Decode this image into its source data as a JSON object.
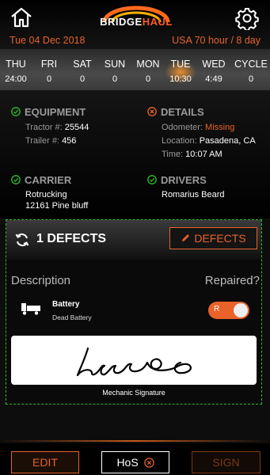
{
  "header": {
    "logo_text_1": "BRIDGE",
    "logo_text_2": "HAUL",
    "date": "Tue 04 Dec 2018",
    "hours_rule": "USA 70 hour / 8 day"
  },
  "days": [
    {
      "name": "THU",
      "value": "24:00"
    },
    {
      "name": "FRI",
      "value": "0"
    },
    {
      "name": "SAT",
      "value": "0"
    },
    {
      "name": "SUN",
      "value": "0"
    },
    {
      "name": "MON",
      "value": "0"
    },
    {
      "name": "TUE",
      "value": "10:30"
    },
    {
      "name": "WED",
      "value": "4:49"
    },
    {
      "name": "CYCLE",
      "value": "0"
    }
  ],
  "equipment": {
    "heading": "EQUIPMENT",
    "tractor_label": "Tractor #:",
    "tractor_value": "25544",
    "trailer_label": "Trailer #:",
    "trailer_value": "456"
  },
  "details": {
    "heading": "DETAILS",
    "odometer_label": "Odometer:",
    "odometer_value": "Missing",
    "location_label": "Location:",
    "location_value": "Pasadena, CA",
    "time_label": "Time:",
    "time_value": "10:07 AM"
  },
  "carrier": {
    "heading": "CARRIER",
    "name": "Rotrucking",
    "address": "12161 Pine bluff"
  },
  "drivers": {
    "heading": "DRIVERS",
    "name": "Romarius Beard"
  },
  "defects": {
    "title": "1 DEFECTS",
    "button_label": "DEFECTS",
    "description_label": "Description",
    "repaired_label": "Repaired?",
    "items": [
      {
        "name": "Battery",
        "description": "Dead Battery",
        "toggle_label": "R"
      }
    ],
    "signature_label": "Mechanic Signature"
  },
  "footer": {
    "edit_label": "EDIT",
    "hos_label": "HoS",
    "sign_label": "SIGN"
  },
  "colors": {
    "accent": "#e8622a",
    "check_green": "#2bbd2b",
    "dashed_border": "#2bbd2b"
  }
}
